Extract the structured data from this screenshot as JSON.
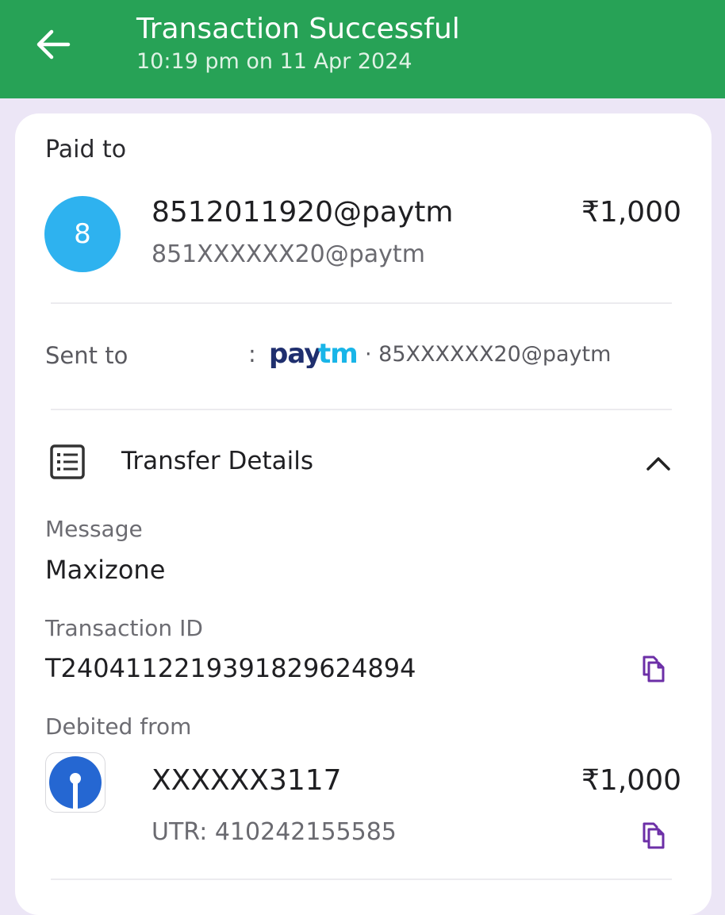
{
  "header": {
    "title": "Transaction Successful",
    "subtitle": "10:19 pm on 11 Apr 2024",
    "color": "#27a256"
  },
  "paid_to": {
    "label": "Paid to",
    "avatar_initial": "8",
    "avatar_color": "#2eb2ef",
    "upi_id": "8512011920@paytm",
    "masked_id": "851XXXXXX20@paytm",
    "amount": "₹1,000"
  },
  "sent_to": {
    "label": "Sent to",
    "separator": ":",
    "app_logo": "paytm-logo",
    "value": "· 85XXXXXX20@paytm"
  },
  "transfer_details": {
    "title": "Transfer Details",
    "icon": "document-list-icon",
    "expanded": true,
    "message_label": "Message",
    "message_value": "Maxizone",
    "txn_label": "Transaction ID",
    "txn_value": "T2404112219391829624894",
    "debited_label": "Debited from",
    "account": "XXXXXX3117",
    "amount": "₹1,000",
    "utr": "UTR: 410242155585",
    "bank_logo": "sbi-logo"
  }
}
